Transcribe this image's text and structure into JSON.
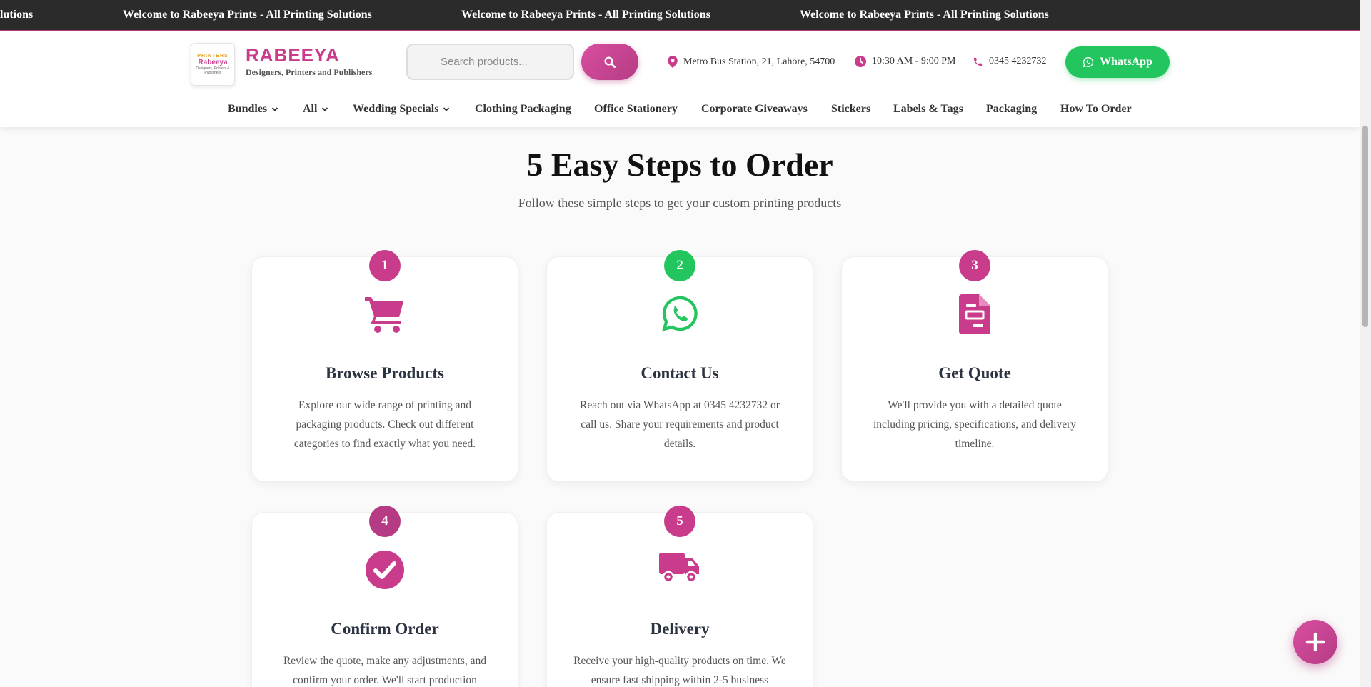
{
  "ticker": {
    "message": "Welcome to Rabeeya Prints - All Printing Solutions",
    "message_cut": "lutions"
  },
  "brand": {
    "logo_top": "PRINTERS",
    "logo_name": "Rabeeya",
    "logo_sub": "Designers, Printers & Publishers",
    "name": "RABEEYA",
    "tagline": "Designers, Printers and Publishers"
  },
  "search": {
    "placeholder": "Search products...",
    "button_icon": "search-icon"
  },
  "contact": {
    "address": "Metro Bus Station, 21, Lahore, 54700",
    "hours": "10:30 AM - 9:00 PM",
    "phone": "0345 4232732",
    "whatsapp_label": "WhatsApp"
  },
  "nav": {
    "items": [
      {
        "label": "Bundles",
        "dropdown": true
      },
      {
        "label": "All",
        "dropdown": true
      },
      {
        "label": "Wedding Specials",
        "dropdown": true
      },
      {
        "label": "Clothing Packaging",
        "dropdown": false
      },
      {
        "label": "Office Stationery",
        "dropdown": false
      },
      {
        "label": "Corporate Giveaways",
        "dropdown": false
      },
      {
        "label": "Stickers",
        "dropdown": false
      },
      {
        "label": "Labels & Tags",
        "dropdown": false
      },
      {
        "label": "Packaging",
        "dropdown": false
      },
      {
        "label": "How To Order",
        "dropdown": false
      }
    ]
  },
  "steps_section": {
    "title": "5 Easy Steps to Order",
    "subtitle": "Follow these simple steps to get your custom printing products",
    "steps": [
      {
        "number": "1",
        "icon": "cart-icon",
        "title": "Browse Products",
        "description": "Explore our wide range of printing and packaging products. Check out different categories to find exactly what you need."
      },
      {
        "number": "2",
        "icon": "whatsapp-icon",
        "title": "Contact Us",
        "description": "Reach out via WhatsApp at 0345 4232732 or call us. Share your requirements and product details."
      },
      {
        "number": "3",
        "icon": "document-icon",
        "title": "Get Quote",
        "description": "We'll provide you with a detailed quote including pricing, specifications, and delivery timeline."
      },
      {
        "number": "4",
        "icon": "check-circle-icon",
        "title": "Confirm Order",
        "description": "Review the quote, make any adjustments, and confirm your order. We'll start production"
      },
      {
        "number": "5",
        "icon": "truck-icon",
        "title": "Delivery",
        "description": "Receive your high-quality products on time. We ensure fast shipping within 2-5 business"
      }
    ]
  },
  "colors": {
    "primary": "#c93c8c",
    "primary_dark": "#b53c84",
    "whatsapp_green": "#22c55e",
    "ticker_bg": "#2b2b2b"
  },
  "fab": {
    "icon": "plus-icon"
  }
}
